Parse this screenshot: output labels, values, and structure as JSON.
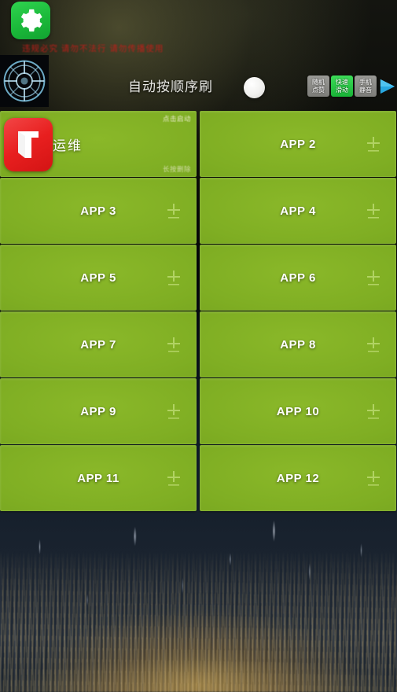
{
  "header": {
    "title": "自动按顺序刷",
    "red_note": "违规必究  请勿不法行  请勿传播使用",
    "gear_icon": "gear-icon",
    "emblem_icon": "compass-emblem-icon",
    "toggle_state": "off"
  },
  "mini_buttons": [
    {
      "name": "random-like-button",
      "line1": "随机",
      "line2": "点赞",
      "style": "grey"
    },
    {
      "name": "fast-swipe-button",
      "line1": "快速",
      "line2": "滑动",
      "style": "green"
    },
    {
      "name": "phone-mute-button",
      "line1": "手机",
      "line2": "静音",
      "style": "grey"
    }
  ],
  "play_button": {
    "name": "play-button",
    "icon": "play-triangle-icon"
  },
  "grid": {
    "corner_top_label": "点击启动",
    "corner_bottom_label": "长按删除",
    "add_icon": "add-plus-icon",
    "app_icon": "tikt-app-icon",
    "cards": [
      {
        "label": "梯影运维",
        "type": "installed",
        "has_icon": true
      },
      {
        "label": "APP 2",
        "type": "empty",
        "has_icon": false
      },
      {
        "label": "APP 3",
        "type": "empty",
        "has_icon": false
      },
      {
        "label": "APP 4",
        "type": "empty",
        "has_icon": false
      },
      {
        "label": "APP 5",
        "type": "empty",
        "has_icon": false
      },
      {
        "label": "APP 6",
        "type": "empty",
        "has_icon": false
      },
      {
        "label": "APP 7",
        "type": "empty",
        "has_icon": false
      },
      {
        "label": "APP 8",
        "type": "empty",
        "has_icon": false
      },
      {
        "label": "APP 9",
        "type": "empty",
        "has_icon": false
      },
      {
        "label": "APP 10",
        "type": "empty",
        "has_icon": false
      },
      {
        "label": "APP 11",
        "type": "empty",
        "has_icon": false
      },
      {
        "label": "APP 12",
        "type": "empty",
        "has_icon": false
      }
    ]
  },
  "colors": {
    "card_green": "#7fae23",
    "accent_green": "#1bb93a",
    "app_icon_red": "#e81f1f",
    "warning_red": "#c41d18",
    "background_dark": "#05070a"
  }
}
